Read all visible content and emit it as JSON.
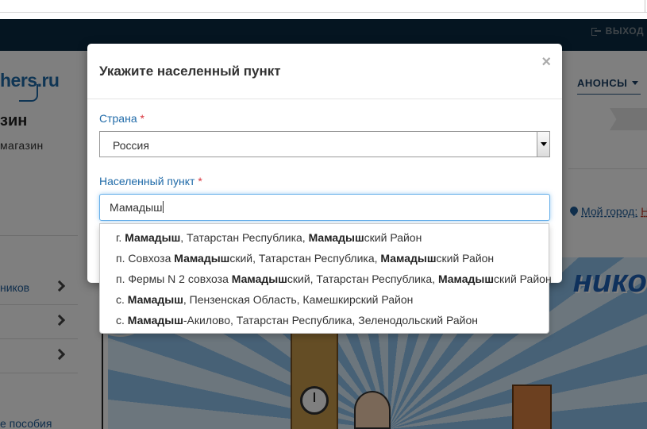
{
  "header": {
    "logout_label": "ВЫХОД",
    "announce_label": "АНОНСЫ"
  },
  "brand": {
    "logo_text": "hers.ru",
    "title": "зин",
    "subtitle": "магазин"
  },
  "location": {
    "mycity_label": "Мой город:",
    "mycity_tail": "Н"
  },
  "sidebar": {
    "items": [
      {
        "label": "ников"
      },
      {
        "label": ""
      },
      {
        "label": ""
      }
    ],
    "bottom_link": "е пособия"
  },
  "promo": {
    "text": "нико"
  },
  "modal": {
    "title": "Укажите населенный пункт",
    "close_symbol": "×",
    "country_label": "Страна",
    "country_value": "Россия",
    "city_label": "Населенный пункт",
    "required_mark": "*",
    "city_value": "Мамадыш"
  },
  "suggestions": [
    {
      "parts": [
        {
          "t": "г. ",
          "b": false
        },
        {
          "t": "Мамадыш",
          "b": true
        },
        {
          "t": ", Татарстан Республика, ",
          "b": false
        },
        {
          "t": "Мамадыш",
          "b": true
        },
        {
          "t": "ский Район",
          "b": false
        }
      ]
    },
    {
      "parts": [
        {
          "t": "п. Совхоза ",
          "b": false
        },
        {
          "t": "Мамадыш",
          "b": true
        },
        {
          "t": "ский, Татарстан Республика, ",
          "b": false
        },
        {
          "t": "Мамадыш",
          "b": true
        },
        {
          "t": "ский Район",
          "b": false
        }
      ]
    },
    {
      "parts": [
        {
          "t": "п. Фермы N 2 совхоза ",
          "b": false
        },
        {
          "t": "Мамадыш",
          "b": true
        },
        {
          "t": "ский, Татарстан Республика, ",
          "b": false
        },
        {
          "t": "Мамадыш",
          "b": true
        },
        {
          "t": "ский Район",
          "b": false
        }
      ]
    },
    {
      "parts": [
        {
          "t": "с. ",
          "b": false
        },
        {
          "t": "Мамадыш",
          "b": true
        },
        {
          "t": ", Пензенская Область, Камешкирский Район",
          "b": false
        }
      ]
    },
    {
      "parts": [
        {
          "t": "с. ",
          "b": false
        },
        {
          "t": "Мамадыш",
          "b": true
        },
        {
          "t": "-Акилово, Татарстан Республика, Зеленодольский Район",
          "b": false
        }
      ]
    }
  ]
}
